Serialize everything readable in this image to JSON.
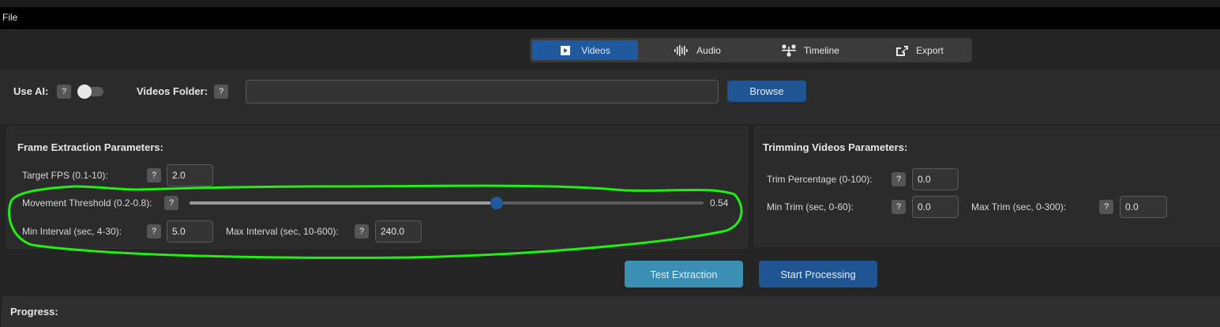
{
  "menu": {
    "file": "File"
  },
  "tabs": [
    {
      "label": "Videos",
      "icon": "video-icon",
      "active": true
    },
    {
      "label": "Audio",
      "icon": "audio-wave-icon",
      "active": false
    },
    {
      "label": "Timeline",
      "icon": "timeline-icon",
      "active": false
    },
    {
      "label": "Export",
      "icon": "export-icon",
      "active": false
    }
  ],
  "top": {
    "use_ai_label": "Use AI:",
    "use_ai_on": false,
    "videos_folder_label": "Videos Folder:",
    "videos_folder_value": "",
    "browse": "Browse",
    "help": "?"
  },
  "frame": {
    "title": "Frame Extraction Parameters:",
    "target_fps_label": "Target FPS (0.1-10):",
    "target_fps_value": "2.0",
    "movement_label": "Movement Threshold (0.2-0.8):",
    "movement_value": "0.54",
    "min_interval_label": "Min Interval (sec, 4-30):",
    "min_interval_value": "5.0",
    "max_interval_label": "Max Interval (sec, 10-600):",
    "max_interval_value": "240.0"
  },
  "trim": {
    "title": "Trimming Videos Parameters:",
    "trim_pct_label": "Trim Percentage (0-100):",
    "trim_pct_value": "0.0",
    "min_trim_label": "Min Trim (sec, 0-60):",
    "min_trim_value": "0.0",
    "max_trim_label": "Max Trim (sec, 0-300):",
    "max_trim_value": "0.0"
  },
  "actions": {
    "test": "Test Extraction",
    "start": "Start Processing"
  },
  "progress": {
    "label": "Progress:"
  },
  "colors": {
    "accent": "#1f5aa0",
    "highlight": "#22ee11",
    "background": "#242424"
  }
}
